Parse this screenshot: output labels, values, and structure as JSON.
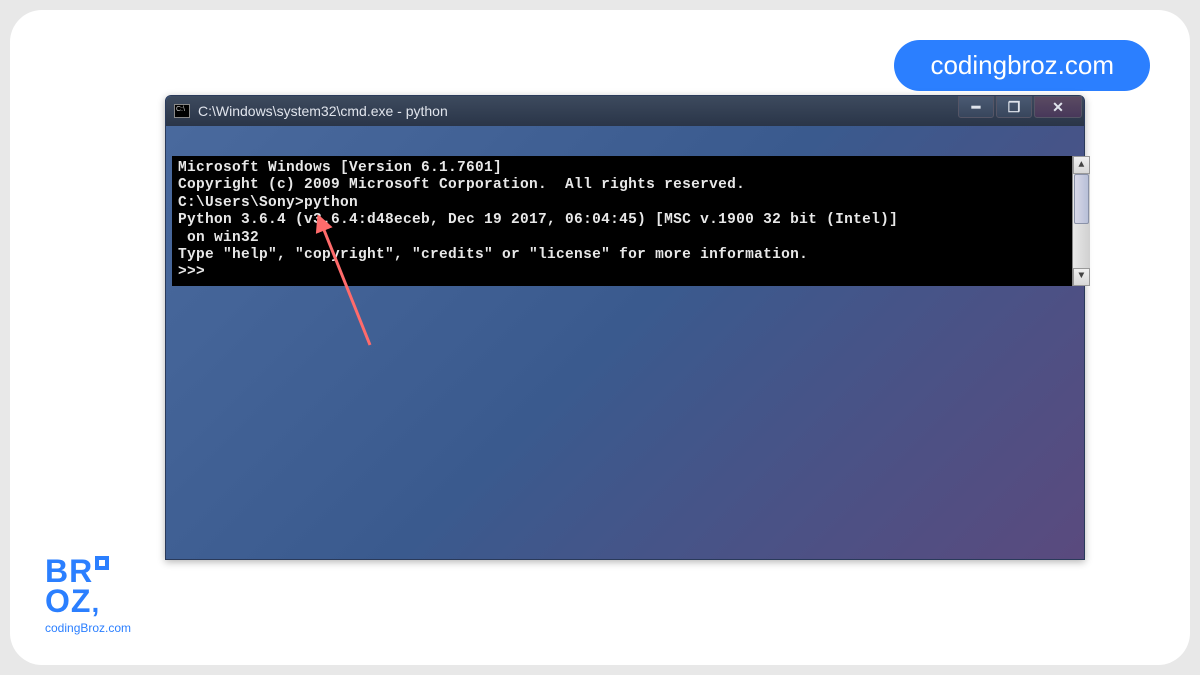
{
  "badge": {
    "label": "codingbroz.com"
  },
  "window": {
    "title": "C:\\Windows\\system32\\cmd.exe - python",
    "controls": {
      "minimize": "━",
      "maximize": "❐",
      "close": "✕"
    }
  },
  "console": {
    "lines": [
      "Microsoft Windows [Version 6.1.7601]",
      "Copyright (c) 2009 Microsoft Corporation.  All rights reserved.",
      "",
      "C:\\Users\\Sony>python",
      "Python 3.6.4 (v3.6.4:d48eceb, Dec 19 2017, 06:04:45) [MSC v.1900 32 bit (Intel)]",
      " on win32",
      "Type \"help\", \"copyright\", \"credits\" or \"license\" for more information.",
      ">>>"
    ]
  },
  "logo": {
    "line1": "BR",
    "line2": "OZ",
    "sub": "codingBroz.com"
  }
}
